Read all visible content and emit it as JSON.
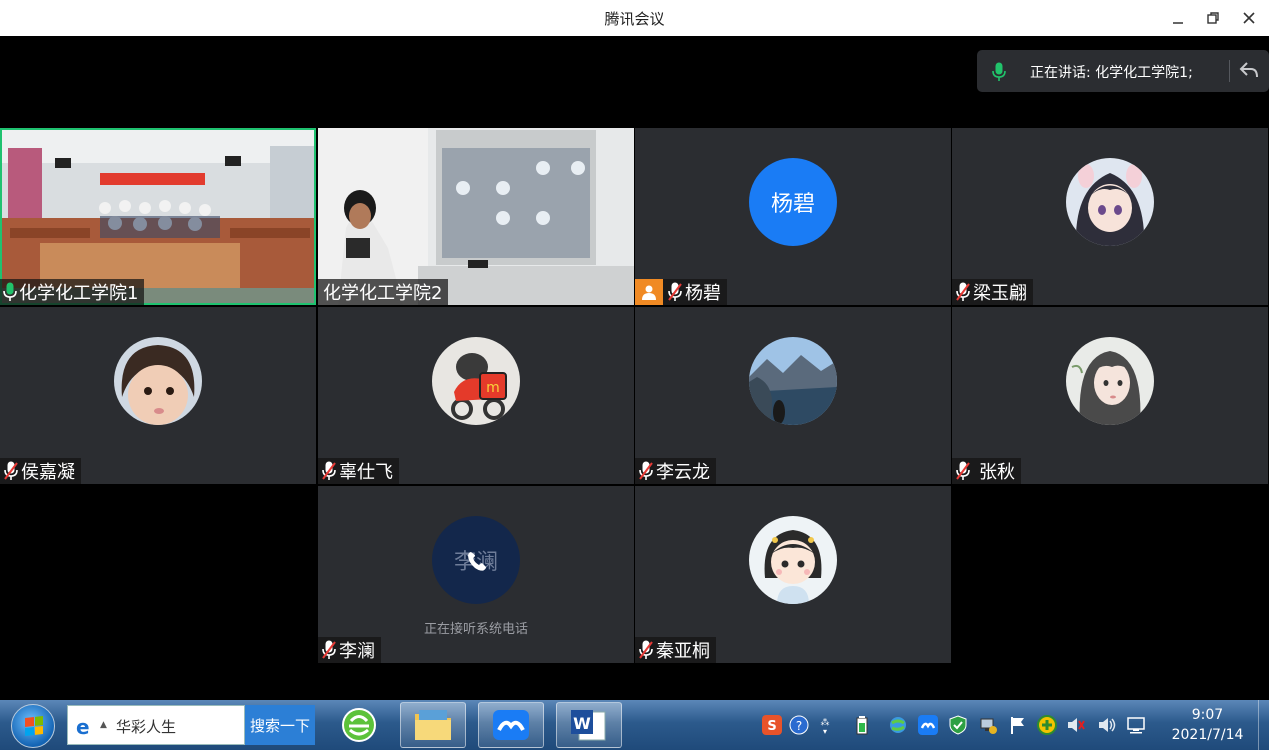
{
  "window": {
    "title": "腾讯会议"
  },
  "speaking": {
    "text": "正在讲话: 化学化工学院1;"
  },
  "tiles": [
    {
      "name": "化学化工学院1",
      "kind": "video-classroom"
    },
    {
      "name": "化学化工学院2",
      "kind": "video-projector"
    },
    {
      "name": "杨碧",
      "kind": "text-avatar",
      "avatar_text": "杨碧",
      "avatar_color": "#1a7cf5",
      "host": true
    },
    {
      "name": "梁玉翩",
      "kind": "anime-avatar"
    },
    {
      "name": "侯嘉凝",
      "kind": "child-avatar"
    },
    {
      "name": "辜仕飞",
      "kind": "cartoon-avatar"
    },
    {
      "name": "李云龙",
      "kind": "landscape-avatar"
    },
    {
      "name": "张秋",
      "kind": "girl-avatar"
    },
    {
      "name": "李澜",
      "kind": "phone",
      "avatar_text": "李澜",
      "status": "正在接听系统电话"
    },
    {
      "name": "秦亚桐",
      "kind": "cartoon-girl-avatar"
    }
  ],
  "taskbar": {
    "search_value": "华彩人生",
    "search_button": "搜索一下",
    "time": "9:07",
    "date": "2021/7/14"
  }
}
